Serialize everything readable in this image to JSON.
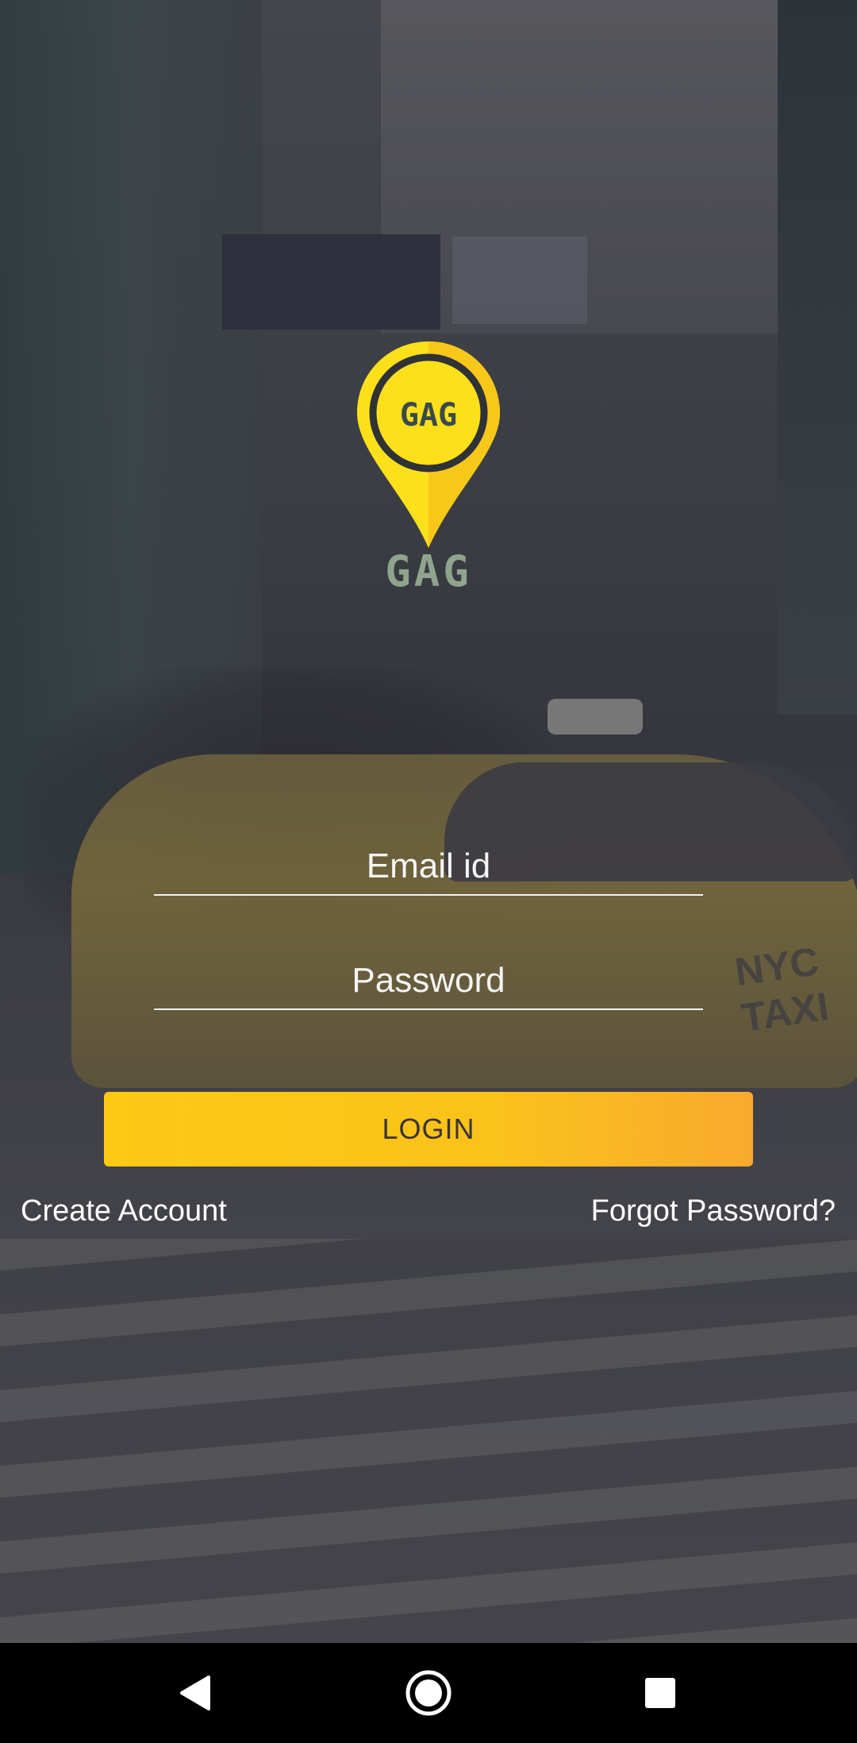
{
  "app": {
    "logo_text": "GAG",
    "pin_label": "GAG"
  },
  "form": {
    "email_placeholder": "Email id",
    "password_placeholder": "Password",
    "login_label": "LOGIN"
  },
  "links": {
    "create_account": "Create Account",
    "forgot_password": "Forgot Password?"
  },
  "background": {
    "taxi_text": "NYC TAXI"
  },
  "nav": {
    "back": "back-icon",
    "home": "home-icon",
    "recents": "recents-icon"
  },
  "colors": {
    "accent": "#fdc914",
    "accent_end": "#f8aa2e",
    "overlay": "#3b3c43"
  }
}
